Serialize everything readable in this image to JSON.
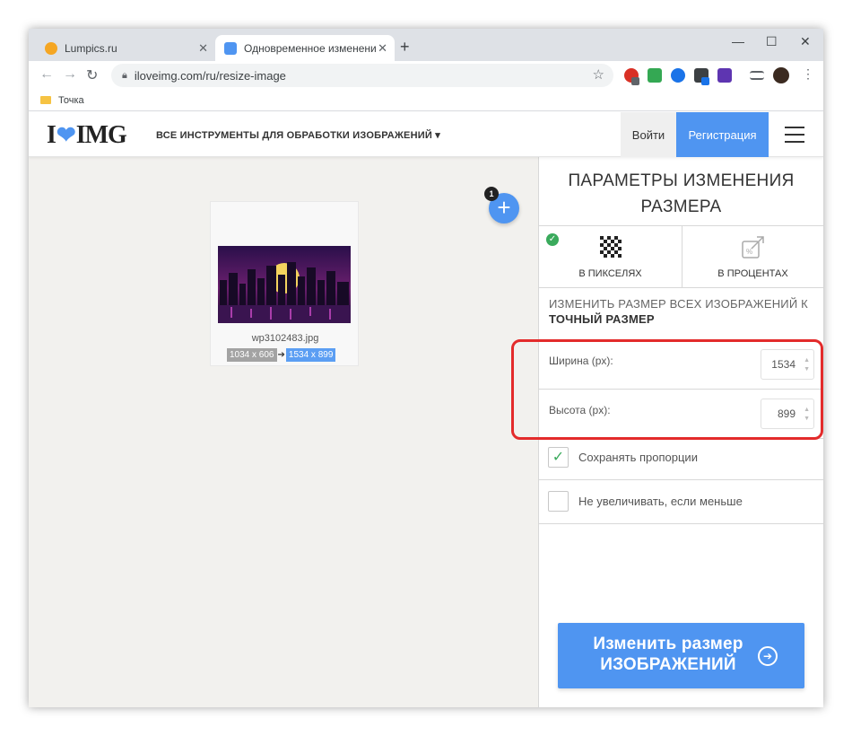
{
  "browser": {
    "tabs": [
      {
        "title": "Lumpics.ru",
        "favicon_color": "#f5a623"
      },
      {
        "title": "Одновременное изменение ра",
        "favicon_color": "#4f95f1"
      }
    ],
    "url": "iloveimg.com/ru/resize-image",
    "bookmark": "Точка"
  },
  "site": {
    "logo": {
      "left": "I",
      "right": "IMG"
    },
    "all_tools": "ВСЕ ИНСТРУМЕНТЫ ДЛЯ ОБРАБОТКИ ИЗОБРАЖЕНИЙ",
    "login": "Войти",
    "register": "Регистрация",
    "accent_color": "#4f95f1"
  },
  "file": {
    "name": "wp3102483.jpg",
    "original_size": "1034 x 606",
    "new_size": "1534 x 899",
    "add_count": "1"
  },
  "sidebar": {
    "title": "ПАРАМЕТРЫ ИЗМЕНЕНИЯ РАЗМЕРА",
    "mode_pixels": "В ПИКСЕЛЯХ",
    "mode_percent": "В ПРОЦЕНТАХ",
    "resize_line1": "ИЗМЕНИТЬ РАЗМЕР ВСЕХ ИЗОБРАЖЕНИЙ К",
    "resize_line2": "ТОЧНЫЙ РАЗМЕР",
    "width_label": "Ширина (px):",
    "width_value": "1534",
    "height_label": "Высота (px):",
    "height_value": "899",
    "keep_ratio": "Сохранять пропорции",
    "no_enlarge": "Не увеличивать, если меньше",
    "submit_line1": "Изменить размер",
    "submit_line2": "ИЗОБРАЖЕНИЙ"
  }
}
